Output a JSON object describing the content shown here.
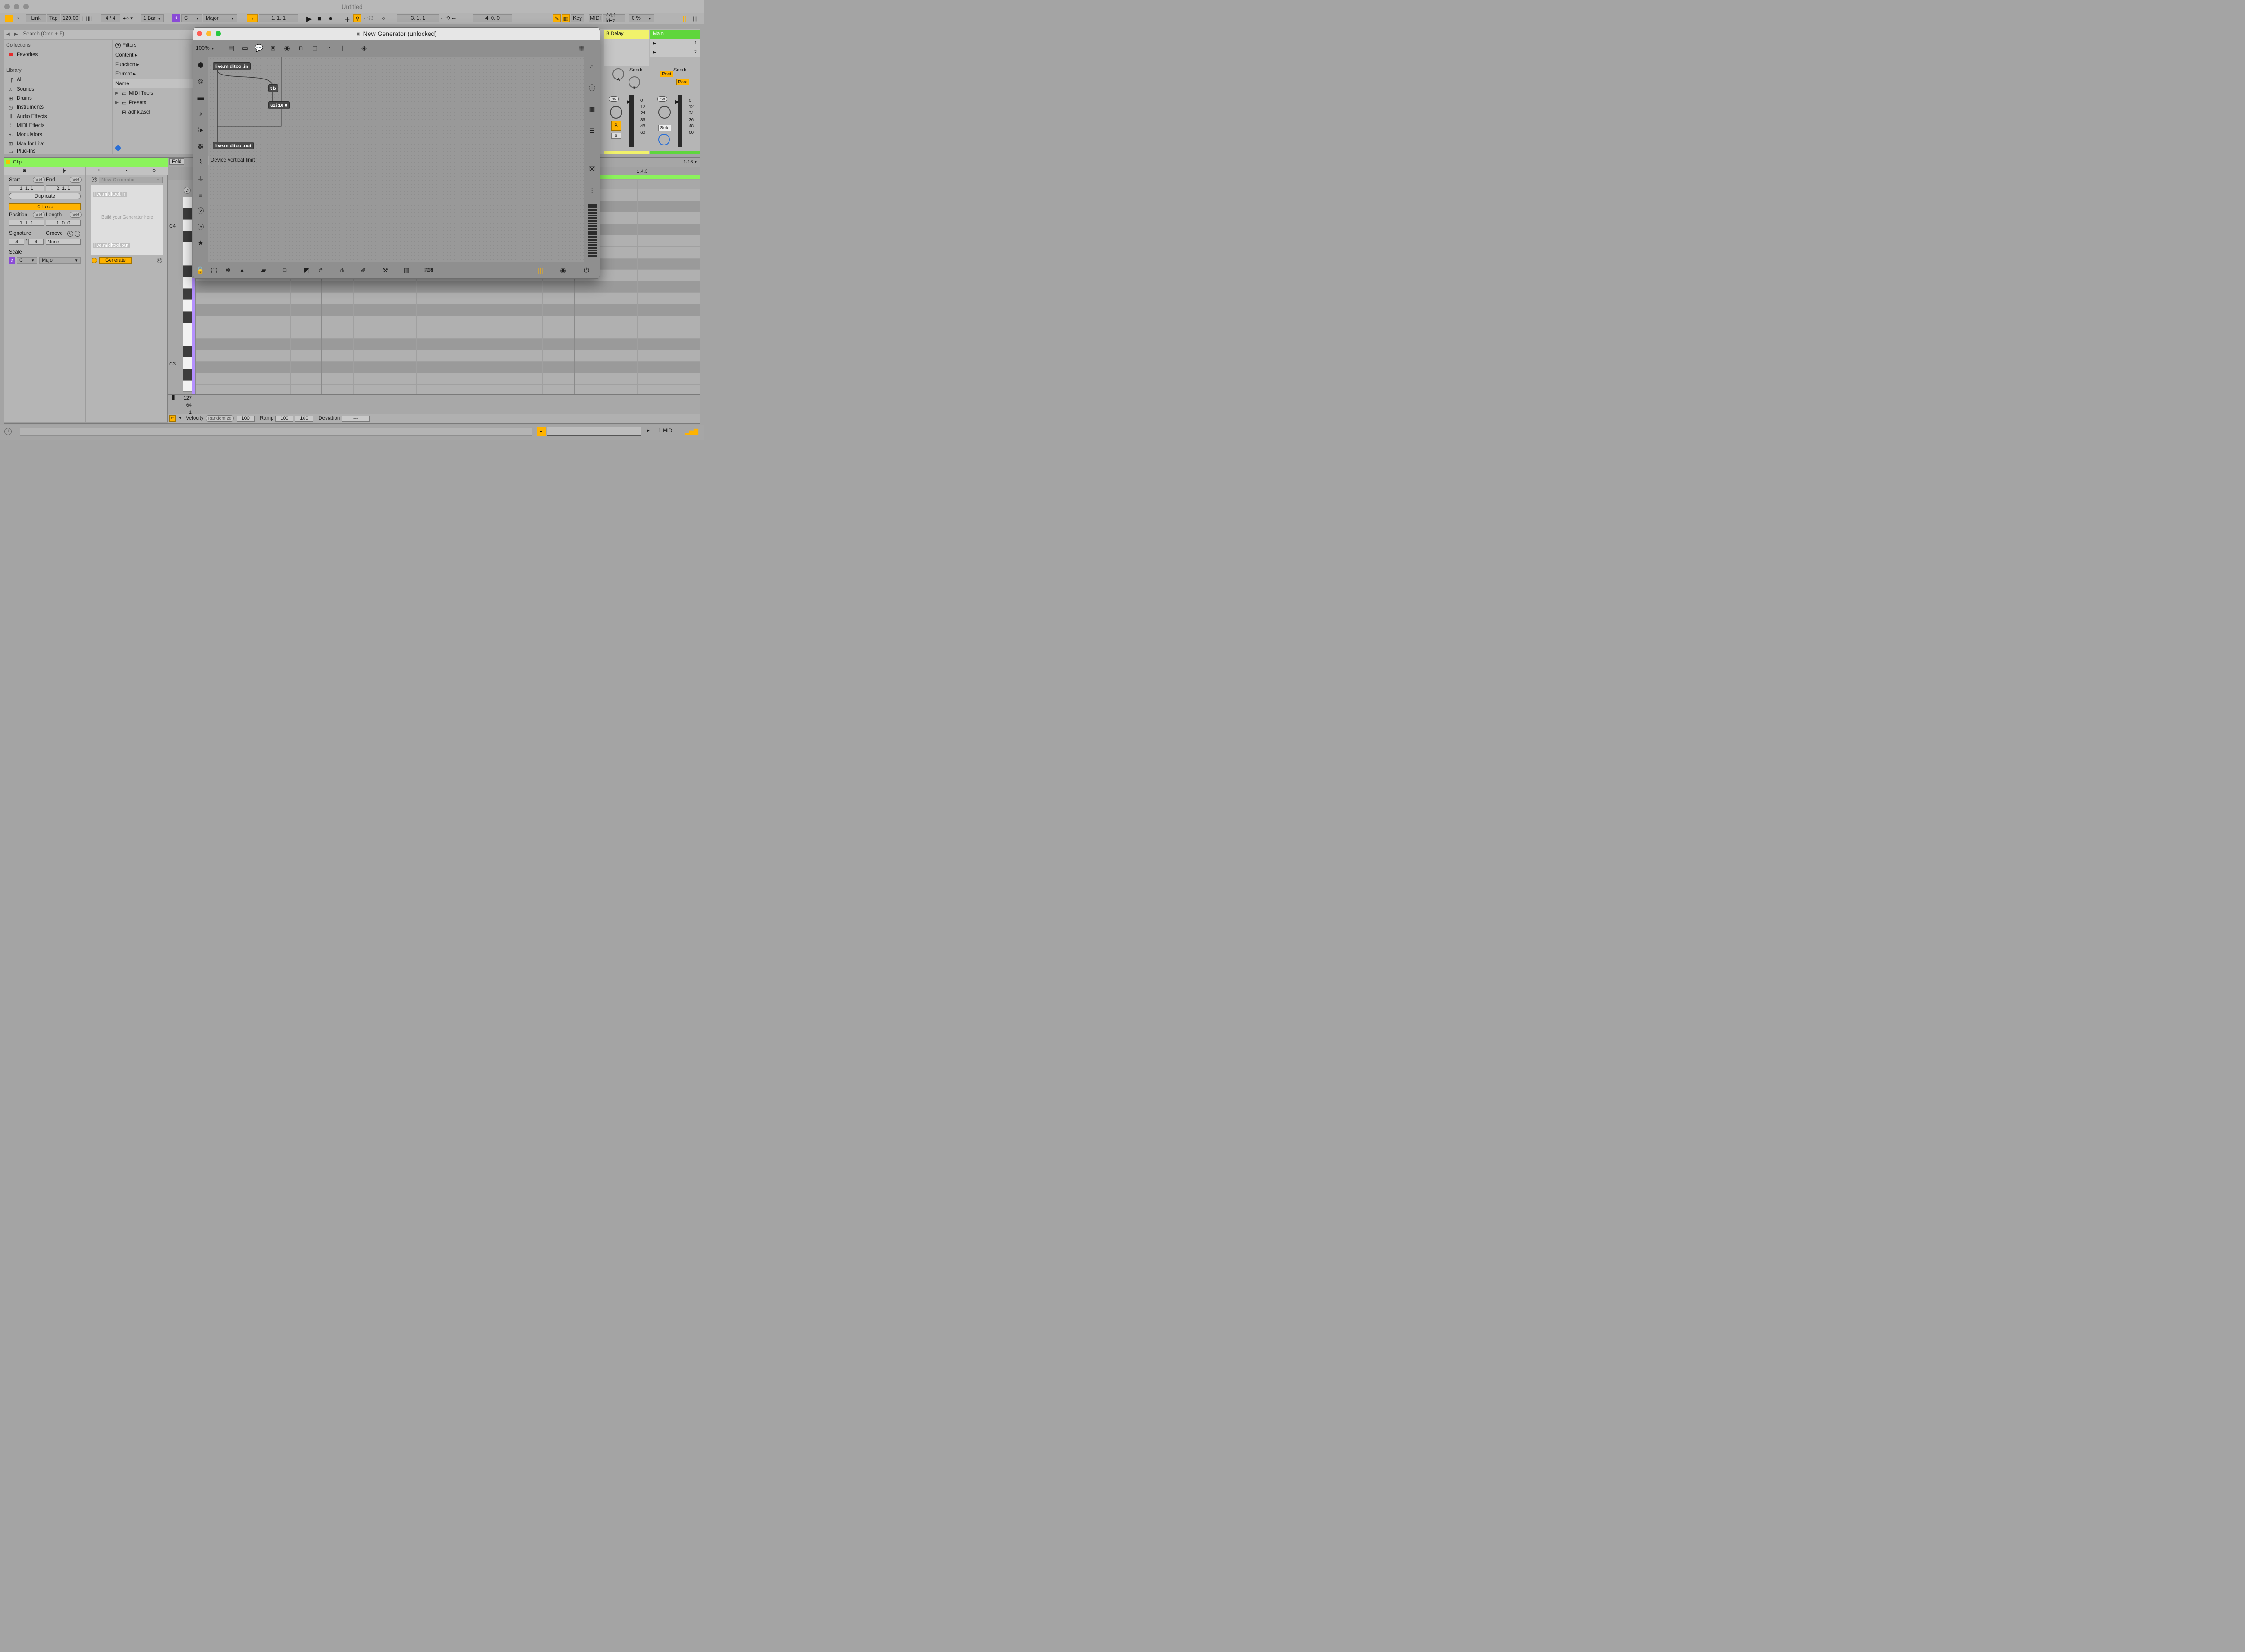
{
  "window": {
    "title": "Untitled"
  },
  "control_bar": {
    "link": "Link",
    "tap": "Tap",
    "tempo": "120.00",
    "signature": "4 / 4",
    "quantize": "1 Bar",
    "scale_root": "C",
    "scale_mode": "Major",
    "arrangement_position": "1.   1.   1",
    "loop_start": "3.   1.   1",
    "loop_length": "4.   0.   0",
    "key": "Key",
    "midi": "MIDI",
    "sample_rate": "44.1 kHz",
    "cpu": "0 %"
  },
  "browser": {
    "search_placeholder": "Search (Cmd + F)",
    "collections_header": "Collections",
    "favorites": "Favorites",
    "library_header": "Library",
    "library_items": [
      {
        "label": "All",
        "icon": "|||\\"
      },
      {
        "label": "Sounds",
        "icon": "♫"
      },
      {
        "label": "Drums",
        "icon": "⊞"
      },
      {
        "label": "Instruments",
        "icon": "◷"
      },
      {
        "label": "Audio Effects",
        "icon": "⫼"
      },
      {
        "label": "MIDI Effects",
        "icon": "⫶"
      },
      {
        "label": "Modulators",
        "icon": "∿"
      },
      {
        "label": "Max for Live",
        "icon": "⊞"
      },
      {
        "label": "Plug-Ins",
        "icon": "▭"
      }
    ],
    "filters_header": "Filters",
    "filter_items": [
      "Content ▸",
      "Function ▸",
      "Format ▸"
    ],
    "name_header": "Name",
    "files": [
      {
        "label": "MIDI Tools",
        "type": "folder"
      },
      {
        "label": "Presets",
        "type": "folder"
      },
      {
        "label": "adhk.ascl",
        "type": "file"
      }
    ]
  },
  "clip": {
    "title": "Clip",
    "start_label": "Start",
    "end_label": "End",
    "set": "Set",
    "start": "1.   1.   1",
    "end": "2.   1.   1",
    "duplicate": "Duplicate",
    "loop": "Loop",
    "position_label": "Position",
    "length_label": "Length",
    "position": "1.   1.   1",
    "length": "1.   0.   0",
    "signature_label": "Signature",
    "groove_label": "Groove",
    "sig_num": "4",
    "sig_den": "4",
    "groove": "None",
    "scale_label": "Scale",
    "scale_root": "C",
    "scale_mode": "Major"
  },
  "generator": {
    "device": "New Generator",
    "preview_in": "live.miditool.in",
    "preview_hint": "Build your Generator here",
    "preview_out": "live.miditool.out",
    "generate": "Generate"
  },
  "piano_roll": {
    "fold": "Fold",
    "grid": "1/16 ▾",
    "marker": "1.4.3",
    "c4": "C4",
    "c3": "C3",
    "vel_ticks": [
      "127",
      "64",
      "1"
    ],
    "velocity": "Velocity",
    "randomize": "Randomize",
    "vel_value": "100",
    "ramp": "Ramp",
    "ramp_a": "100",
    "ramp_b": "100",
    "deviation": "Deviation",
    "deviation_value": "---"
  },
  "mixer": {
    "b_delay": "B Delay",
    "main": "Main",
    "slot1": "1",
    "slot2": "2",
    "sends": "Sends",
    "post": "Post",
    "send_a": "A",
    "send_b": "B",
    "vol_readout": "-∞",
    "track_b": "B",
    "s": "S",
    "solo": "Solo",
    "scale_ticks": [
      "0",
      "12",
      "24",
      "36",
      "48",
      "60"
    ]
  },
  "max": {
    "title": "New Generator (unlocked)",
    "zoom": "100%",
    "objects": {
      "in": "live.miditool.in",
      "tb": "t b",
      "uzi": "uzi 16 0",
      "out": "live.miditool.out",
      "comment": "Device vertical limit"
    }
  },
  "status": {
    "track": "1-MIDI"
  }
}
